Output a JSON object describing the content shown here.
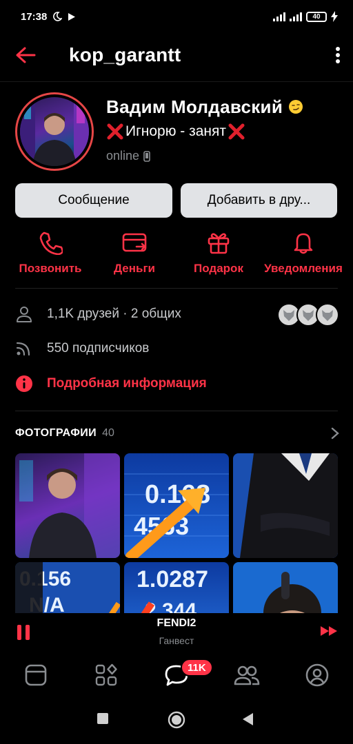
{
  "status_bar": {
    "time": "17:38",
    "battery": "40"
  },
  "header": {
    "username": "kop_garantt"
  },
  "profile": {
    "name": "Вадим Молдавский",
    "status": "Игнорю - занят",
    "online": "online"
  },
  "buttons": {
    "message": "Сообщение",
    "add_friend": "Добавить в дру..."
  },
  "actions": [
    {
      "label": "Позвонить",
      "icon": "phone-icon"
    },
    {
      "label": "Деньги",
      "icon": "money-icon"
    },
    {
      "label": "Подарок",
      "icon": "gift-icon"
    },
    {
      "label": "Уведомления",
      "icon": "bell-icon"
    }
  ],
  "info": {
    "friends": "1,1K друзей · 2 общих",
    "followers": "550 подписчиков",
    "details": "Подробная информация"
  },
  "photos": {
    "label": "ФОТОГРАФИИ",
    "count": "40"
  },
  "player": {
    "track": "FENDI2",
    "artist": "Ганвест"
  },
  "tabbar": {
    "messages_badge": "11K"
  },
  "colors": {
    "accent": "#ff3347",
    "button_bg": "#e1e3e6",
    "background": "#000000"
  }
}
